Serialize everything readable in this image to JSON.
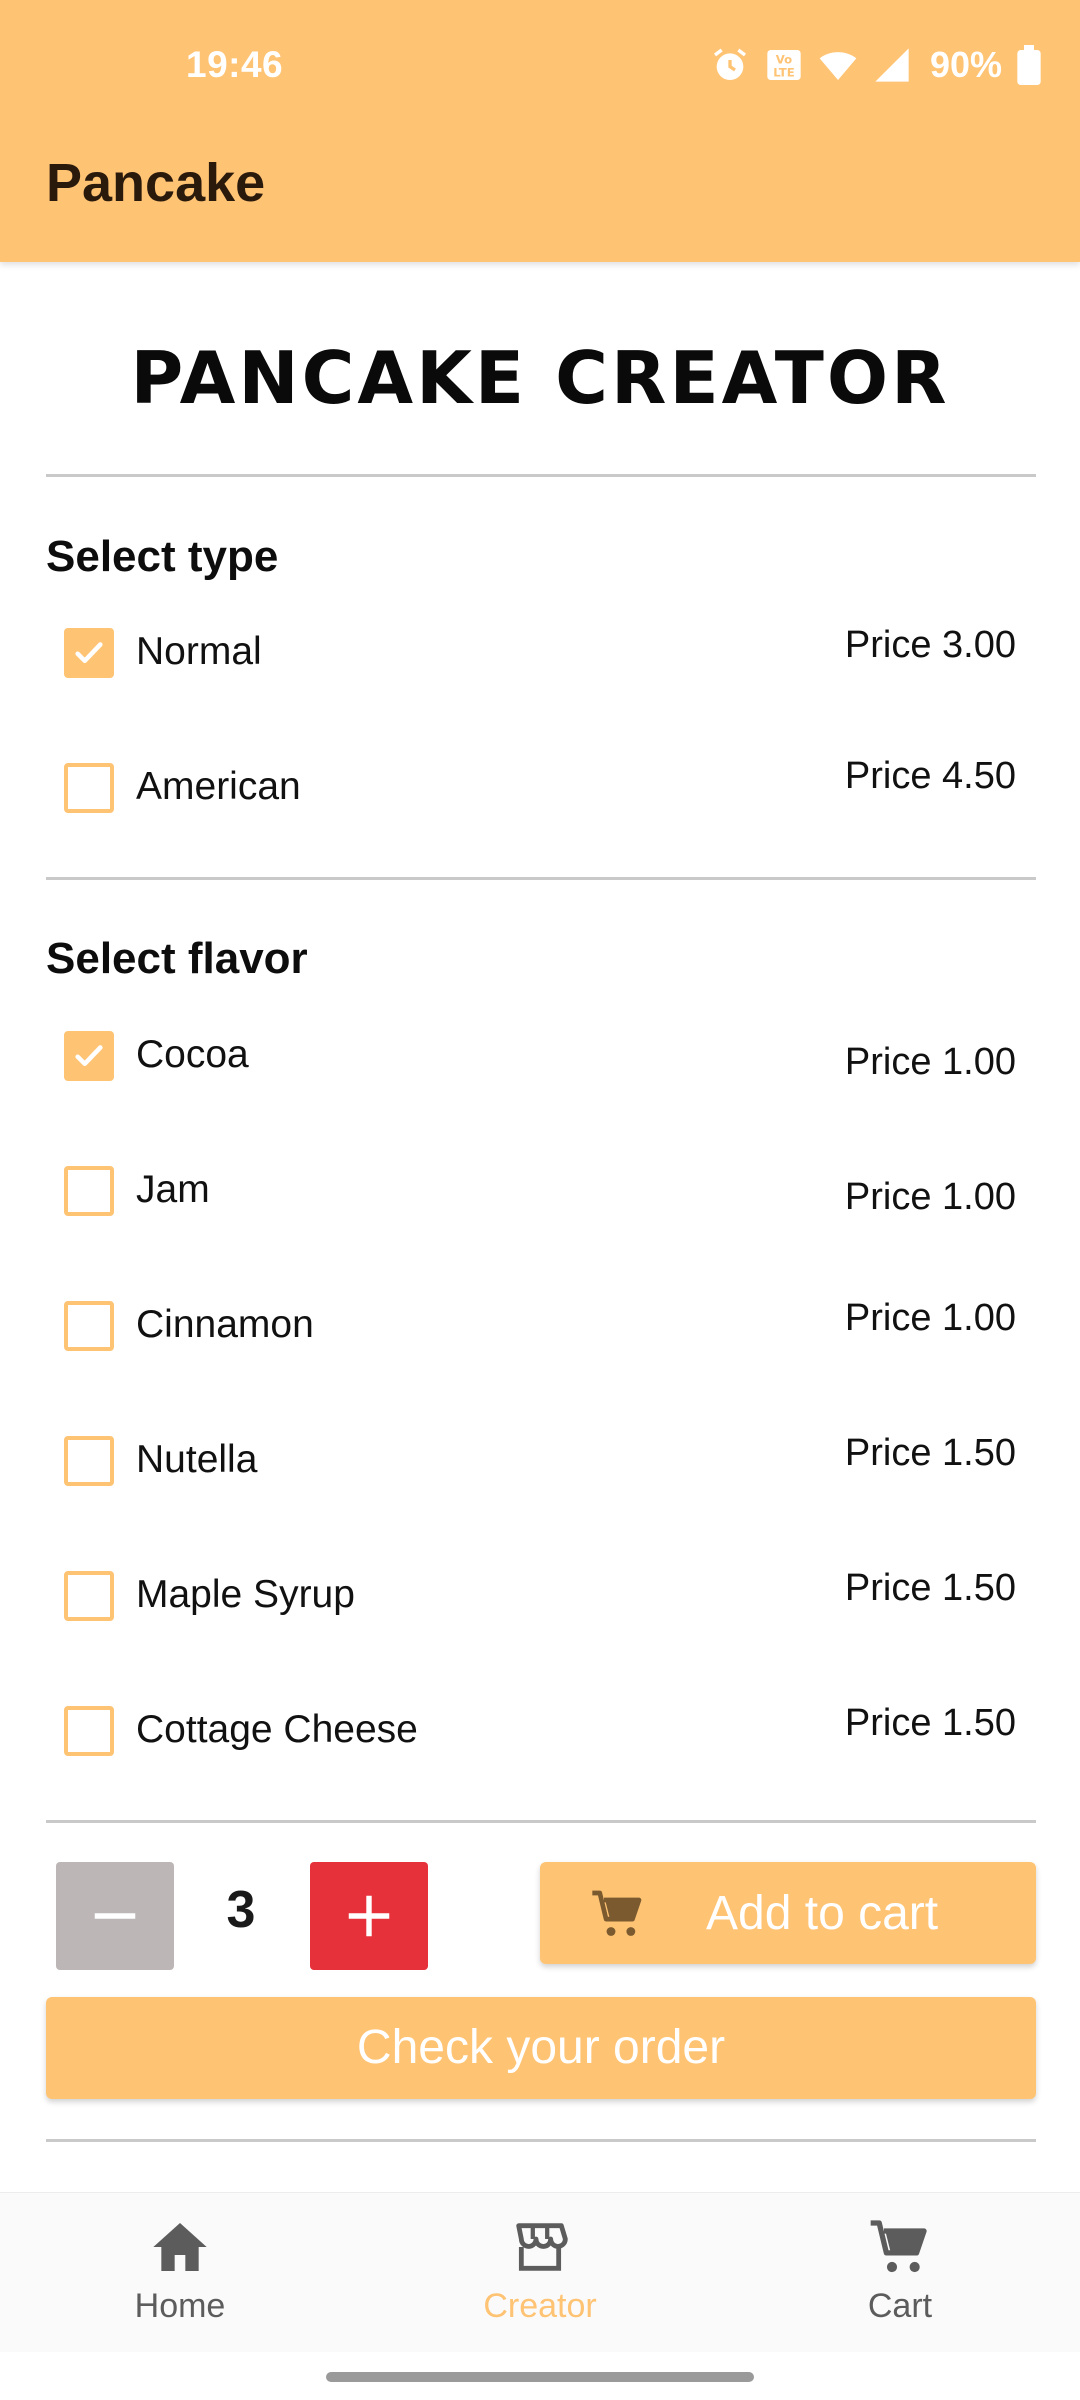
{
  "status_bar": {
    "time": "19:46",
    "battery": "90%",
    "icons": [
      "alarm-icon",
      "volte-icon",
      "wifi-icon",
      "signal-icon",
      "battery-icon"
    ]
  },
  "app_bar": {
    "title": "Pancake"
  },
  "heading": "PANCAKE CREATOR",
  "type_section": {
    "title": "Select type",
    "options": [
      {
        "label": "Normal",
        "price": "Price 3.00",
        "checked": true
      },
      {
        "label": "American",
        "price": "Price 4.50",
        "checked": false
      }
    ]
  },
  "flavor_section": {
    "title": "Select flavor",
    "options": [
      {
        "label": "Cocoa",
        "price": "Price 1.00",
        "checked": true
      },
      {
        "label": "Jam",
        "price": "Price 1.00",
        "checked": false
      },
      {
        "label": "Cinnamon",
        "price": "Price 1.00",
        "checked": false
      },
      {
        "label": "Nutella",
        "price": "Price 1.50",
        "checked": false
      },
      {
        "label": "Maple Syrup",
        "price": "Price 1.50",
        "checked": false
      },
      {
        "label": "Cottage Cheese",
        "price": "Price 1.50",
        "checked": false
      }
    ]
  },
  "quantity": {
    "value": "3"
  },
  "actions": {
    "add_to_cart": "Add to cart",
    "check_order": "Check your order"
  },
  "bottom_nav": {
    "items": [
      {
        "label": "Home",
        "icon": "home-icon",
        "active": false
      },
      {
        "label": "Creator",
        "icon": "store-icon",
        "active": true
      },
      {
        "label": "Cart",
        "icon": "cart-icon",
        "active": false
      }
    ]
  },
  "colors": {
    "accent": "#FFC374",
    "plus_button": "#E6303A",
    "minus_button": "#BDB6B6"
  }
}
